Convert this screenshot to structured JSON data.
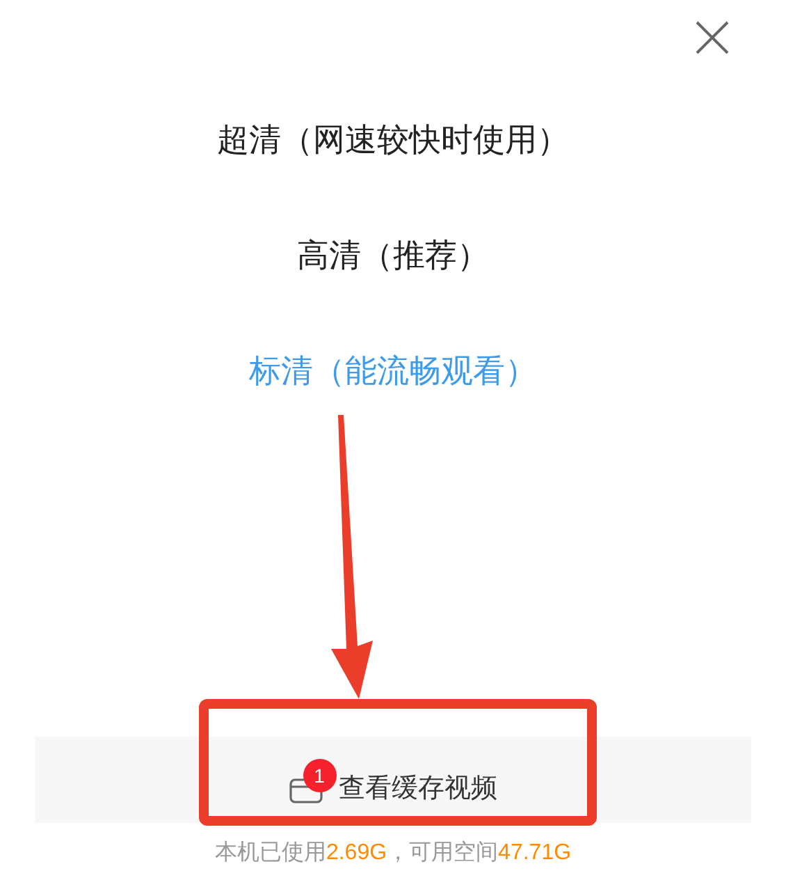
{
  "options": [
    {
      "label": "超清（网速较快时使用）",
      "selected": false
    },
    {
      "label": "高清（推荐）",
      "selected": false
    },
    {
      "label": "标清（能流畅观看）",
      "selected": true
    }
  ],
  "cache_button": {
    "label": "查看缓存视频",
    "badge": "1"
  },
  "storage": [
    {
      "text": "本机已使用",
      "highlight": false
    },
    {
      "text": "2.69G",
      "highlight": true
    },
    {
      "text": "，可用空间",
      "highlight": false
    },
    {
      "text": "47.71G",
      "highlight": true
    }
  ]
}
